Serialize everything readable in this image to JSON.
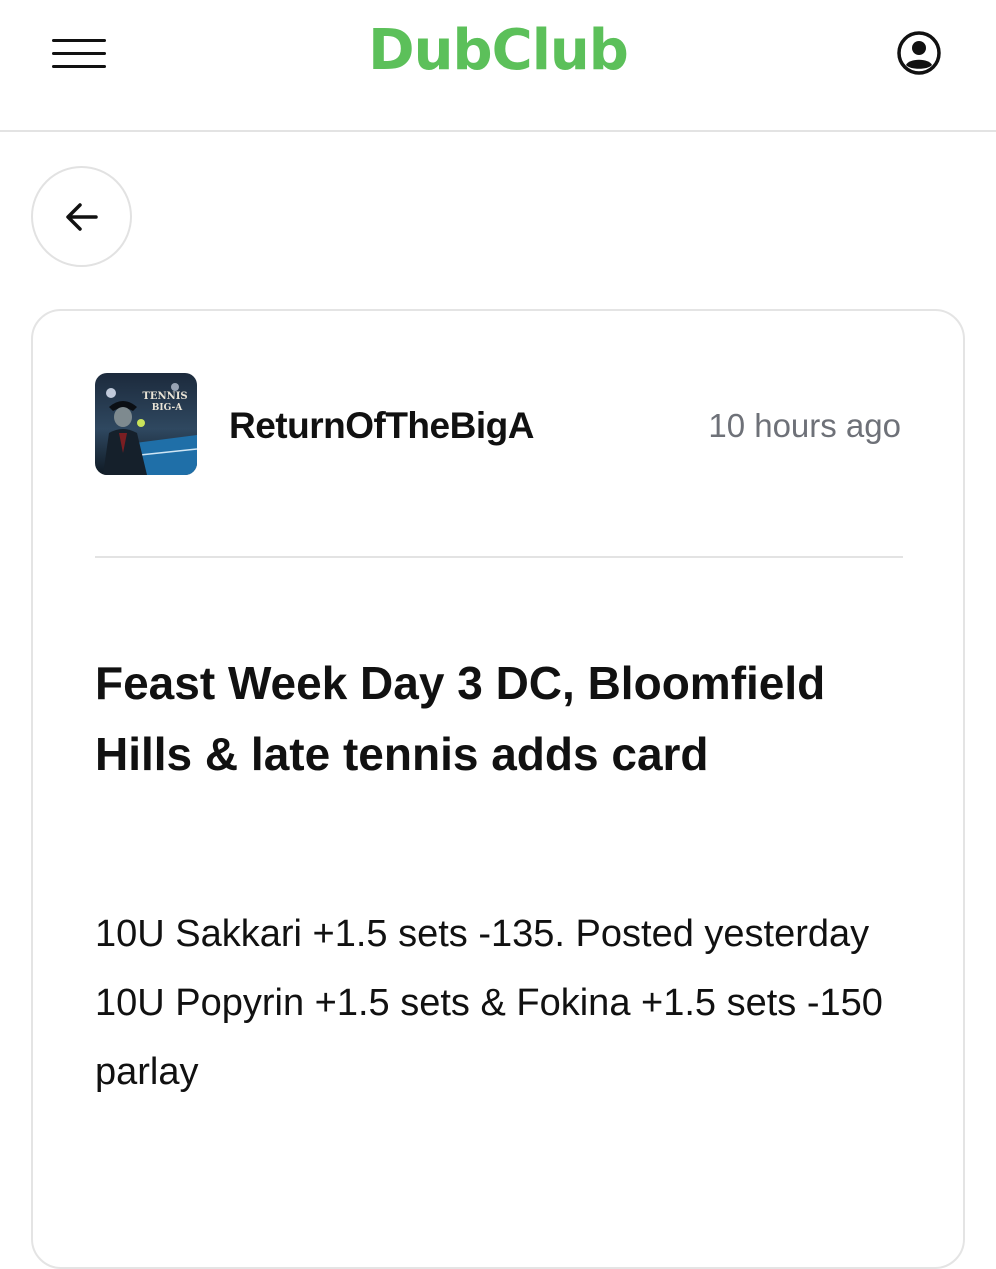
{
  "header": {
    "logo": "DubClub",
    "brand_color": "#5cc05a",
    "menu_icon": "hamburger-menu-icon",
    "profile_icon": "user-circle-icon"
  },
  "nav": {
    "back_icon": "arrow-left-icon"
  },
  "post": {
    "author": "ReturnOfTheBigA",
    "timestamp": "10 hours ago",
    "avatar_text": "TENNIS BIG-A",
    "title": "Feast Week Day 3 DC, Bloomfield Hills & late tennis adds card",
    "lines": [
      "10U Sakkari +1.5 sets -135. Posted yesterday",
      "10U Popyrin +1.5 sets & Fokina +1.5 sets -150 parlay"
    ]
  }
}
